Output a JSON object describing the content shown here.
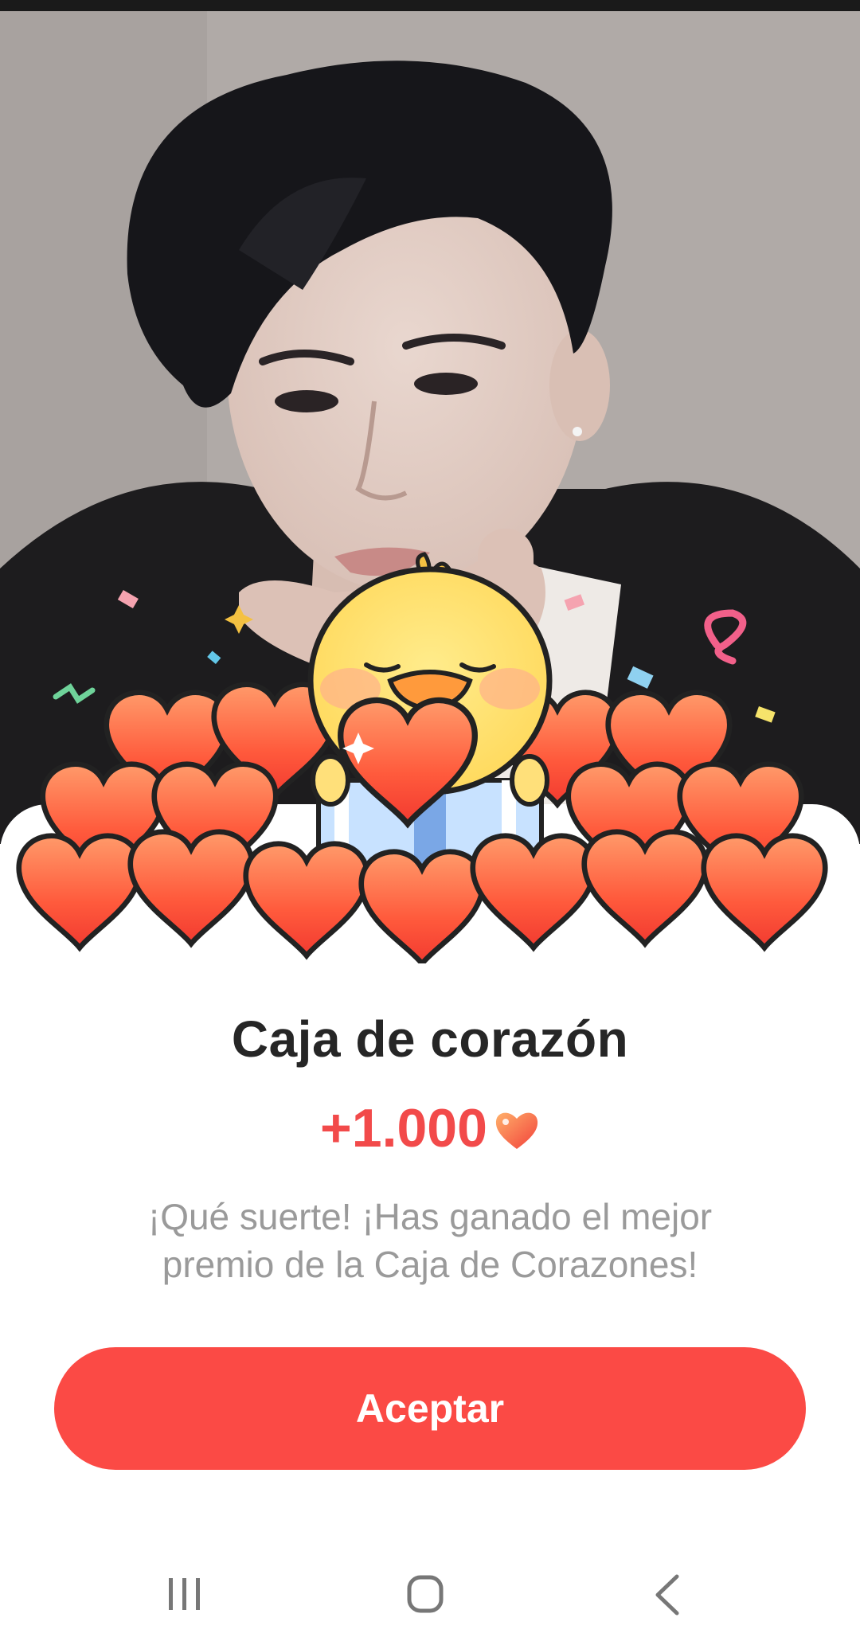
{
  "dialog": {
    "title": "Caja de corazón",
    "reward_amount": "+1.000",
    "message": "¡Qué suerte! ¡Has ganado el mejor premio de la Caja de Corazones!",
    "accept_label": "Aceptar"
  },
  "icons": {
    "reward_icon": "heart-icon",
    "mascot": "yellow-chick-holding-heart",
    "nav_recent": "recent-apps-icon",
    "nav_home": "home-icon",
    "nav_back": "back-icon"
  },
  "colors": {
    "accent": "#fb4a45",
    "reward_text": "#f24a4a",
    "title_text": "#262626",
    "message_text": "#9a9a9a"
  }
}
